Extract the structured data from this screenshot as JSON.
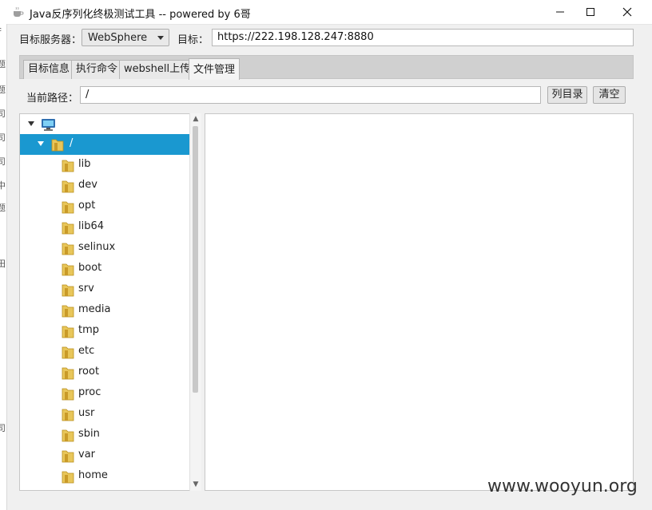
{
  "window": {
    "title": "Java反序列化终极测试工具  -- powered by 6哥",
    "controls": [
      "minimize",
      "maximize",
      "close"
    ]
  },
  "target_bar": {
    "server_label": "目标服务器：",
    "server_value": "WebSphere",
    "target_label": "目标：",
    "target_value": "https://222.198.128.247:8880"
  },
  "tabs": [
    {
      "label": "目标信息",
      "active": false
    },
    {
      "label": "执行命令",
      "active": false
    },
    {
      "label": "webshell上传",
      "active": false
    },
    {
      "label": "文件管理",
      "active": true
    }
  ],
  "path_bar": {
    "label": "当前路径：",
    "value": "/",
    "list_button": "列目录",
    "clear_button": "清空"
  },
  "tree": {
    "root_icon": "computer-icon",
    "selected": "/",
    "children": [
      "lib",
      "dev",
      "opt",
      "lib64",
      "selinux",
      "boot",
      "srv",
      "media",
      "tmp",
      "etc",
      "root",
      "proc",
      "usr",
      "sbin",
      "var",
      "home"
    ]
  },
  "left_strip_glyphs": [
    "Ja",
    "扌",
    "题",
    "题",
    "司",
    "司",
    "司",
    "中",
    "题",
    "田",
    "司"
  ],
  "watermark": "www.wooyun.org",
  "colors": {
    "selection": "#1a98d0",
    "folder": "#e8c65a"
  }
}
